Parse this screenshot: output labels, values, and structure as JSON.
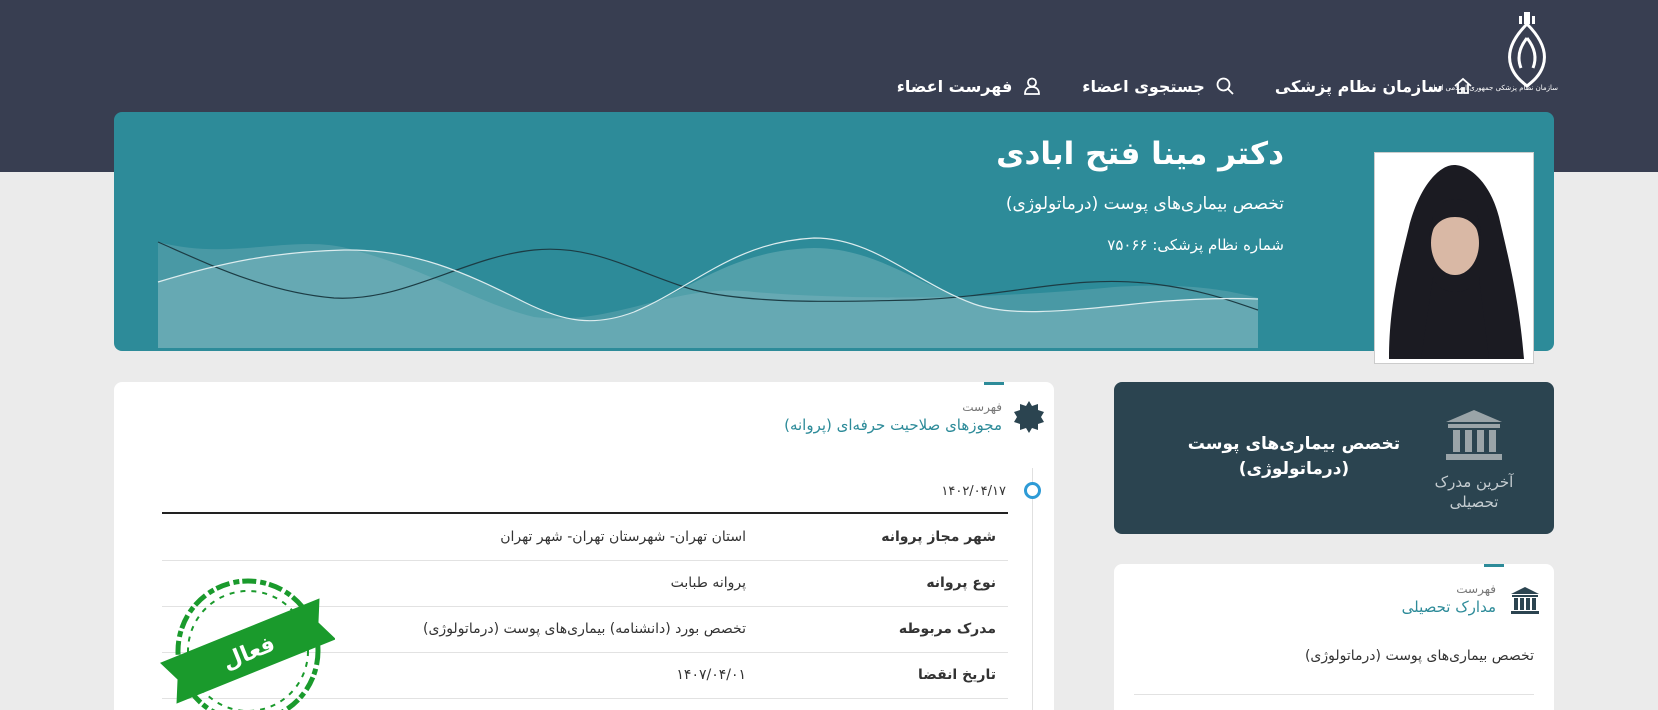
{
  "header": {
    "logo_caption": "سازمان نظام پزشکی جمهوری اسلامی ایران",
    "nav": [
      {
        "label": "سازمان نظام پزشکی",
        "icon": "home-icon"
      },
      {
        "label": "جستجوی اعضاء",
        "icon": "search-icon"
      },
      {
        "label": "فهرست اعضاء",
        "icon": "user-icon"
      }
    ]
  },
  "profile": {
    "name": "دکتر مینا فتح ابادی",
    "specialty": "تخصص بیماری‌های پوست (درماتولوژی)",
    "number_label": "شماره نظام پزشکی:",
    "number_value": "۷۵۰۶۶"
  },
  "degree_card": {
    "icon": "institution-icon",
    "label": "آخرین مدرک تحصیلی",
    "value": "تخصص بیماری‌های پوست (درماتولوژی)"
  },
  "education": {
    "subtitle": "فهرست",
    "title": "مدارک تحصیلی",
    "items": [
      "تخصص بیماری‌های پوست (درماتولوژی)"
    ]
  },
  "licenses": {
    "subtitle": "فهرست",
    "title": "مجوزهای صلاحیت حرفه‌ای (پروانه)",
    "date": "۱۴۰۲/۰۴/۱۷",
    "rows": [
      {
        "key": "شهر مجاز پروانه",
        "value": "استان تهران- شهرستان تهران- شهر تهران"
      },
      {
        "key": "نوع پروانه",
        "value": "پروانه طبابت"
      },
      {
        "key": "مدرک مربوطه",
        "value": "تخصص بورد (دانشنامه) بیماری‌های پوست (درماتولوژی)"
      },
      {
        "key": "تاریخ انقضا",
        "value": "۱۴۰۷/۰۴/۰۱"
      }
    ],
    "stamp_text": "فعال"
  },
  "colors": {
    "topbar": "#383e51",
    "hero": "#2d8b99",
    "degree_card": "#2b4450",
    "accent": "#2d8b99",
    "timeline_dot": "#2e9bd6",
    "stamp": "#1a9a2c"
  }
}
